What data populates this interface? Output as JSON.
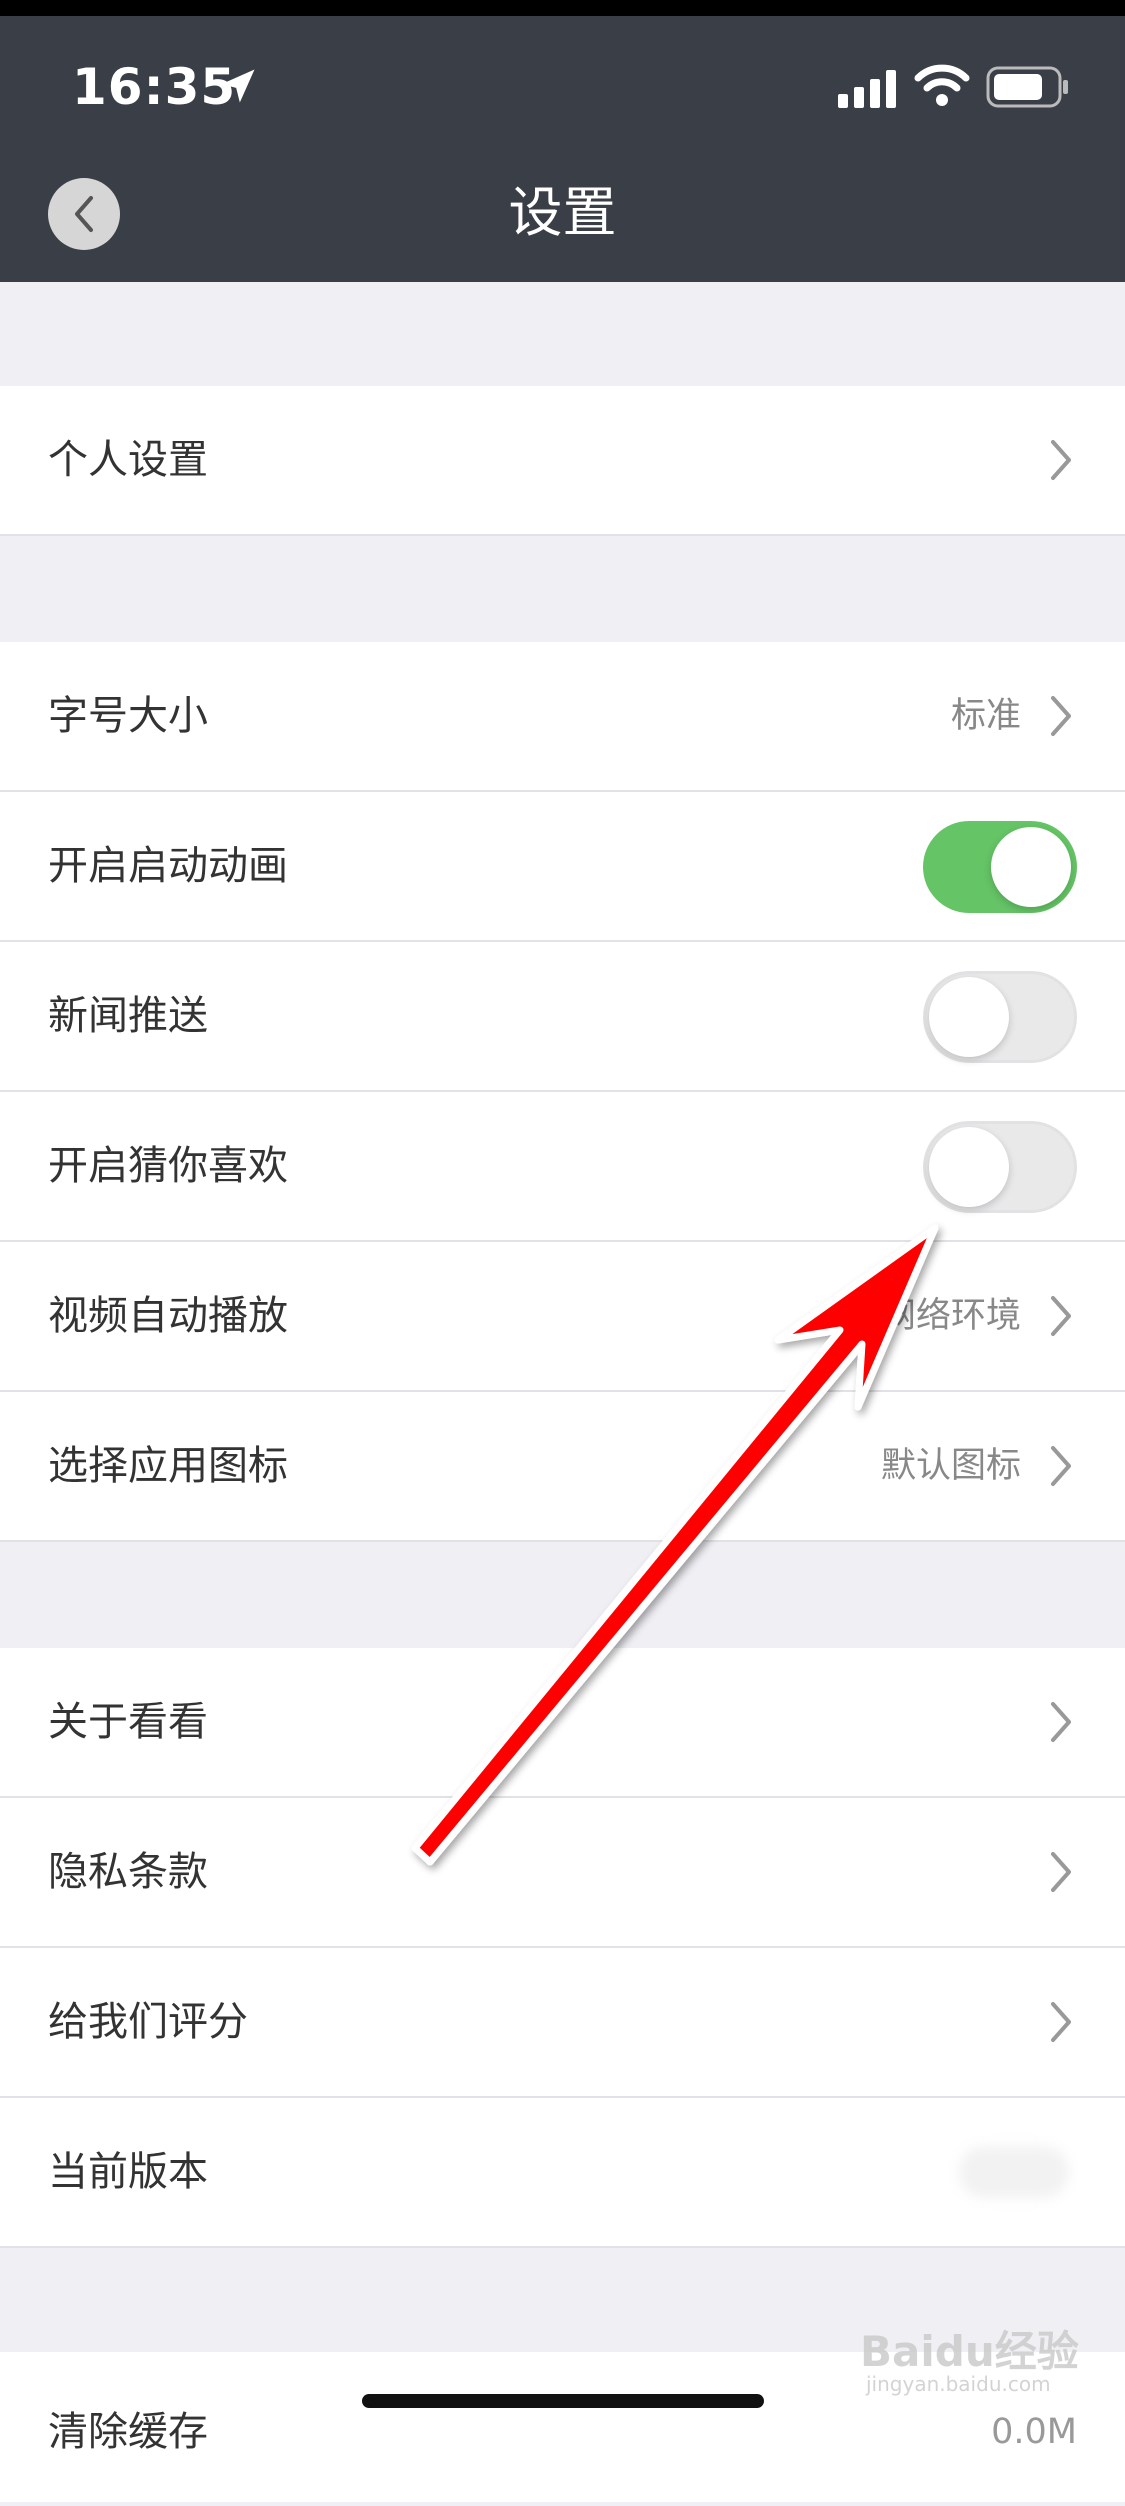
{
  "status_bar": {
    "time": "16:35"
  },
  "nav": {
    "title": "设置"
  },
  "group1": [
    {
      "label": "个人设置"
    }
  ],
  "group2": [
    {
      "label": "字号大小",
      "value": "标准"
    },
    {
      "label": "开启启动动画",
      "toggle": "on"
    },
    {
      "label": "新闻推送",
      "toggle": "off"
    },
    {
      "label": "开启猜你喜欢",
      "toggle": "off"
    },
    {
      "label": "视频自动播放",
      "value": "网络环境"
    },
    {
      "label": "选择应用图标",
      "value": "默认图标"
    }
  ],
  "group3": [
    {
      "label": "关于看看"
    },
    {
      "label": "隐私条款"
    },
    {
      "label": "给我们评分"
    },
    {
      "label": "当前版本"
    }
  ],
  "group4": [
    {
      "label": "清除缓存",
      "value": "0.0M"
    }
  ],
  "colors": {
    "nav_bg": "#3a3e47",
    "toggle_on": "#65c466",
    "arrow": "#ff0000"
  },
  "watermark": {
    "brand": "Baidu经验",
    "url": "jingyan.baidu.com"
  }
}
